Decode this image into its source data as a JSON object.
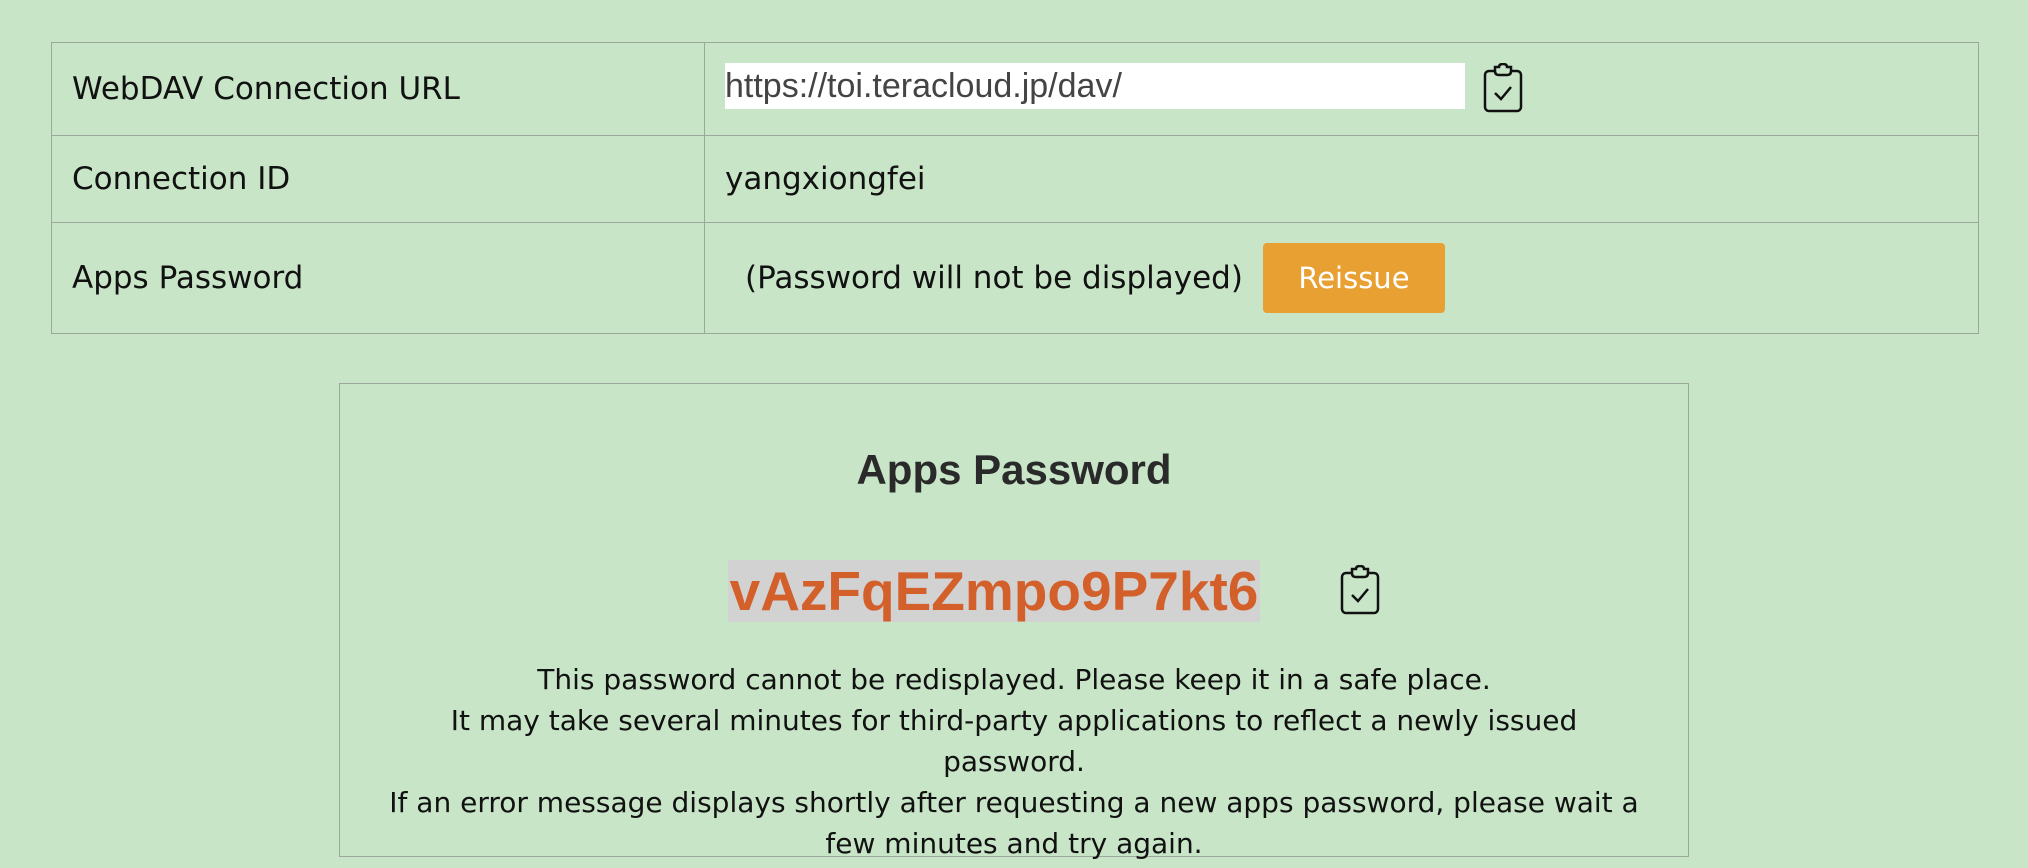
{
  "table": {
    "rows": [
      {
        "label": "WebDAV Connection URL",
        "value": "https://toi.teracloud.jp/dav/"
      },
      {
        "label": "Connection ID",
        "value": "yangxiongfei"
      },
      {
        "label": "Apps Password",
        "note": "(Password will not be displayed)",
        "button": "Reissue"
      }
    ]
  },
  "panel": {
    "title": "Apps Password",
    "password": "vAzFqEZmpo9P7kt6",
    "messages": [
      "This password cannot be redisplayed. Please keep it in a safe place.",
      "It may take several minutes for third-party applications to reflect a newly issued password.",
      "If an error message displays shortly after requesting a new apps password, please wait a few minutes and try again."
    ]
  },
  "icons": {
    "copy": "clipboard-check-icon"
  },
  "colors": {
    "background": "#c8e5c8",
    "reissue_button": "#e8a032",
    "password_text": "#d35f2a",
    "password_highlight": "#d2d2d2"
  }
}
